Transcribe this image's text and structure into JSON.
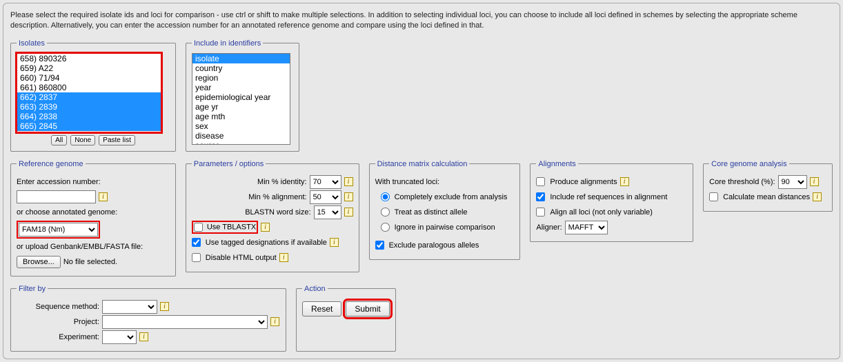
{
  "intro": "Please select the required isolate ids and loci for comparison - use ctrl or shift to make multiple selections. In addition to selecting individual loci, you can choose to include all loci defined in schemes by selecting the appropriate scheme description. Alternatively, you can enter the accession number for an annotated reference genome and compare using the loci defined in that.",
  "isolates": {
    "legend": "Isolates",
    "items": [
      "658) 890326",
      "659) A22",
      "660) 71/94",
      "661) 860800",
      "662) 2837",
      "663) 2839",
      "664) 2838",
      "665) 2845"
    ],
    "selected": [
      4,
      5,
      6,
      7
    ],
    "buttons": {
      "all": "All",
      "none": "None",
      "paste": "Paste list"
    }
  },
  "identifiers": {
    "legend": "Include in identifiers",
    "items": [
      "isolate",
      "country",
      "region",
      "year",
      "epidemiological year",
      "age yr",
      "age mth",
      "sex",
      "disease",
      "source"
    ],
    "selected": [
      0
    ]
  },
  "refgenome": {
    "legend": "Reference genome",
    "enter_accession": "Enter accession number:",
    "or_choose": "or choose annotated genome:",
    "genome_value": "FAM18 (Nm)",
    "or_upload": "or upload Genbank/EMBL/FASTA file:",
    "browse": "Browse...",
    "nofile": "No file selected."
  },
  "params": {
    "legend": "Parameters / options",
    "min_identity": "Min % identity:",
    "min_identity_val": "70",
    "min_alignment": "Min % alignment:",
    "min_alignment_val": "50",
    "blastn": "BLASTN word size:",
    "blastn_val": "15",
    "use_tblastx": "Use TBLASTX",
    "use_tagged": "Use tagged designations if available",
    "disable_html": "Disable HTML output"
  },
  "distance": {
    "legend": "Distance matrix calculation",
    "with_truncated": "With truncated loci:",
    "opt1": "Completely exclude from analysis",
    "opt2": "Treat as distinct allele",
    "opt3": "Ignore in pairwise comparison",
    "exclude_para": "Exclude paralogous alleles"
  },
  "align": {
    "legend": "Alignments",
    "produce": "Produce alignments",
    "include_ref": "Include ref sequences in alignment",
    "align_all": "Align all loci (not only variable)",
    "aligner": "Aligner:",
    "aligner_val": "MAFFT"
  },
  "core": {
    "legend": "Core genome analysis",
    "threshold": "Core threshold (%):",
    "threshold_val": "90",
    "calc_mean": "Calculate mean distances"
  },
  "filter": {
    "legend": "Filter by",
    "seq_method": "Sequence method:",
    "project": "Project:",
    "experiment": "Experiment:"
  },
  "action": {
    "legend": "Action",
    "reset": "Reset",
    "submit": "Submit"
  }
}
